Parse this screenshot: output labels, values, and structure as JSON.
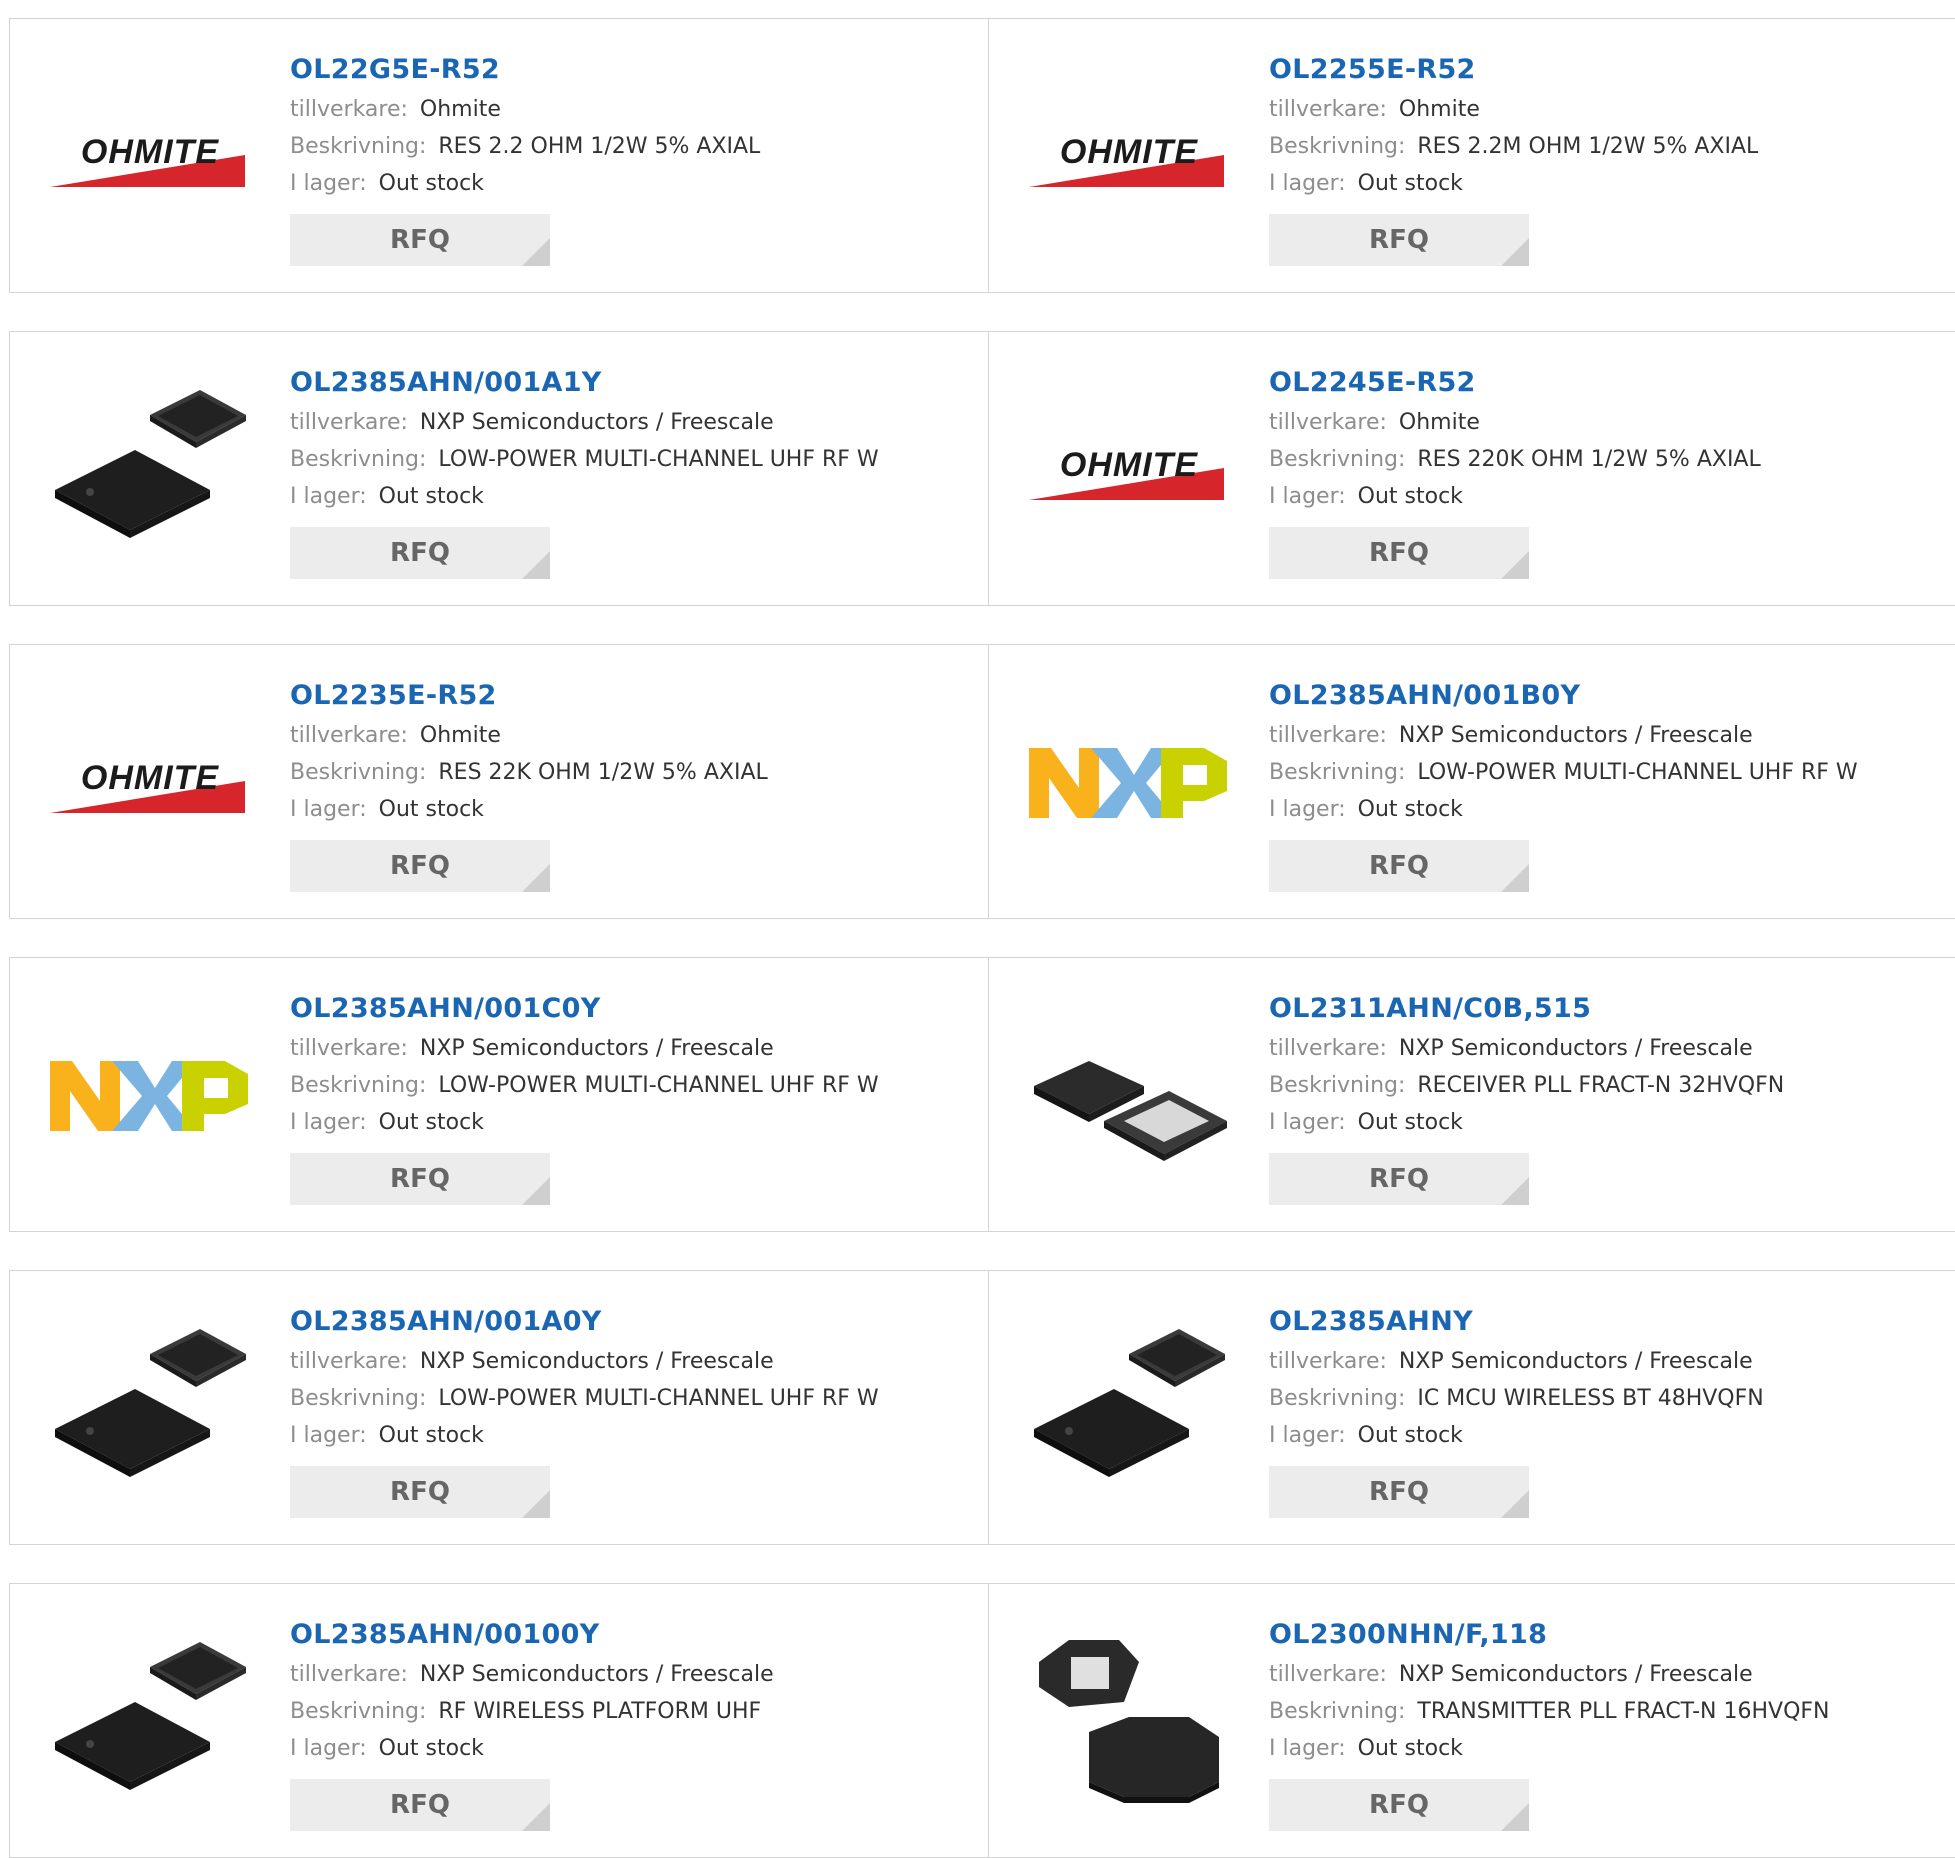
{
  "labels": {
    "manufacturer": "tillverkare:",
    "description": "Beskrivning:",
    "stock": "I lager:",
    "rfq": "RFQ"
  },
  "products": [
    {
      "part": "OL22G5E-R52",
      "manufacturer": "Ohmite",
      "description": "RES 2.2 OHM 1/2W 5% AXIAL",
      "stock": "Out stock",
      "image": "ohmite-logo"
    },
    {
      "part": "OL2255E-R52",
      "manufacturer": "Ohmite",
      "description": "RES 2.2M OHM 1/2W 5% AXIAL",
      "stock": "Out stock",
      "image": "ohmite-logo"
    },
    {
      "part": "OL2385AHN/001A1Y",
      "manufacturer": "NXP Semiconductors / Freescale",
      "description": "LOW-POWER MULTI-CHANNEL UHF RF W",
      "stock": "Out stock",
      "image": "qfn-chip-pair"
    },
    {
      "part": "OL2245E-R52",
      "manufacturer": "Ohmite",
      "description": "RES 220K OHM 1/2W 5% AXIAL",
      "stock": "Out stock",
      "image": "ohmite-logo"
    },
    {
      "part": "OL2235E-R52",
      "manufacturer": "Ohmite",
      "description": "RES 22K OHM 1/2W 5% AXIAL",
      "stock": "Out stock",
      "image": "ohmite-logo"
    },
    {
      "part": "OL2385AHN/001B0Y",
      "manufacturer": "NXP Semiconductors / Freescale",
      "description": "LOW-POWER MULTI-CHANNEL UHF RF W",
      "stock": "Out stock",
      "image": "nxp-logo"
    },
    {
      "part": "OL2385AHN/001C0Y",
      "manufacturer": "NXP Semiconductors / Freescale",
      "description": "LOW-POWER MULTI-CHANNEL UHF RF W",
      "stock": "Out stock",
      "image": "nxp-logo"
    },
    {
      "part": "OL2311AHN/C0B,515",
      "manufacturer": "NXP Semiconductors / Freescale",
      "description": "RECEIVER PLL FRACT-N 32HVQFN",
      "stock": "Out stock",
      "image": "hvqfn-chip-pair"
    },
    {
      "part": "OL2385AHN/001A0Y",
      "manufacturer": "NXP Semiconductors / Freescale",
      "description": "LOW-POWER MULTI-CHANNEL UHF RF W",
      "stock": "Out stock",
      "image": "qfn-chip-pair"
    },
    {
      "part": "OL2385AHNY",
      "manufacturer": "NXP Semiconductors / Freescale",
      "description": "IC MCU WIRELESS BT 48HVQFN",
      "stock": "Out stock",
      "image": "qfn-chip-pair"
    },
    {
      "part": "OL2385AHN/00100Y",
      "manufacturer": "NXP Semiconductors / Freescale",
      "description": "RF WIRELESS PLATFORM UHF",
      "stock": "Out stock",
      "image": "qfn-chip-pair"
    },
    {
      "part": "OL2300NHN/F,118",
      "manufacturer": "NXP Semiconductors / Freescale",
      "description": "TRANSMITTER PLL FRACT-N 16HVQFN",
      "stock": "Out stock",
      "image": "hvqfn16-chip-pair"
    }
  ],
  "colors": {
    "link": "#1a66b3",
    "label": "#8d8d8d",
    "value": "#333333",
    "border": "#d4d4d4",
    "button_bg": "#ececec",
    "ohmite_red": "#d7262b"
  }
}
